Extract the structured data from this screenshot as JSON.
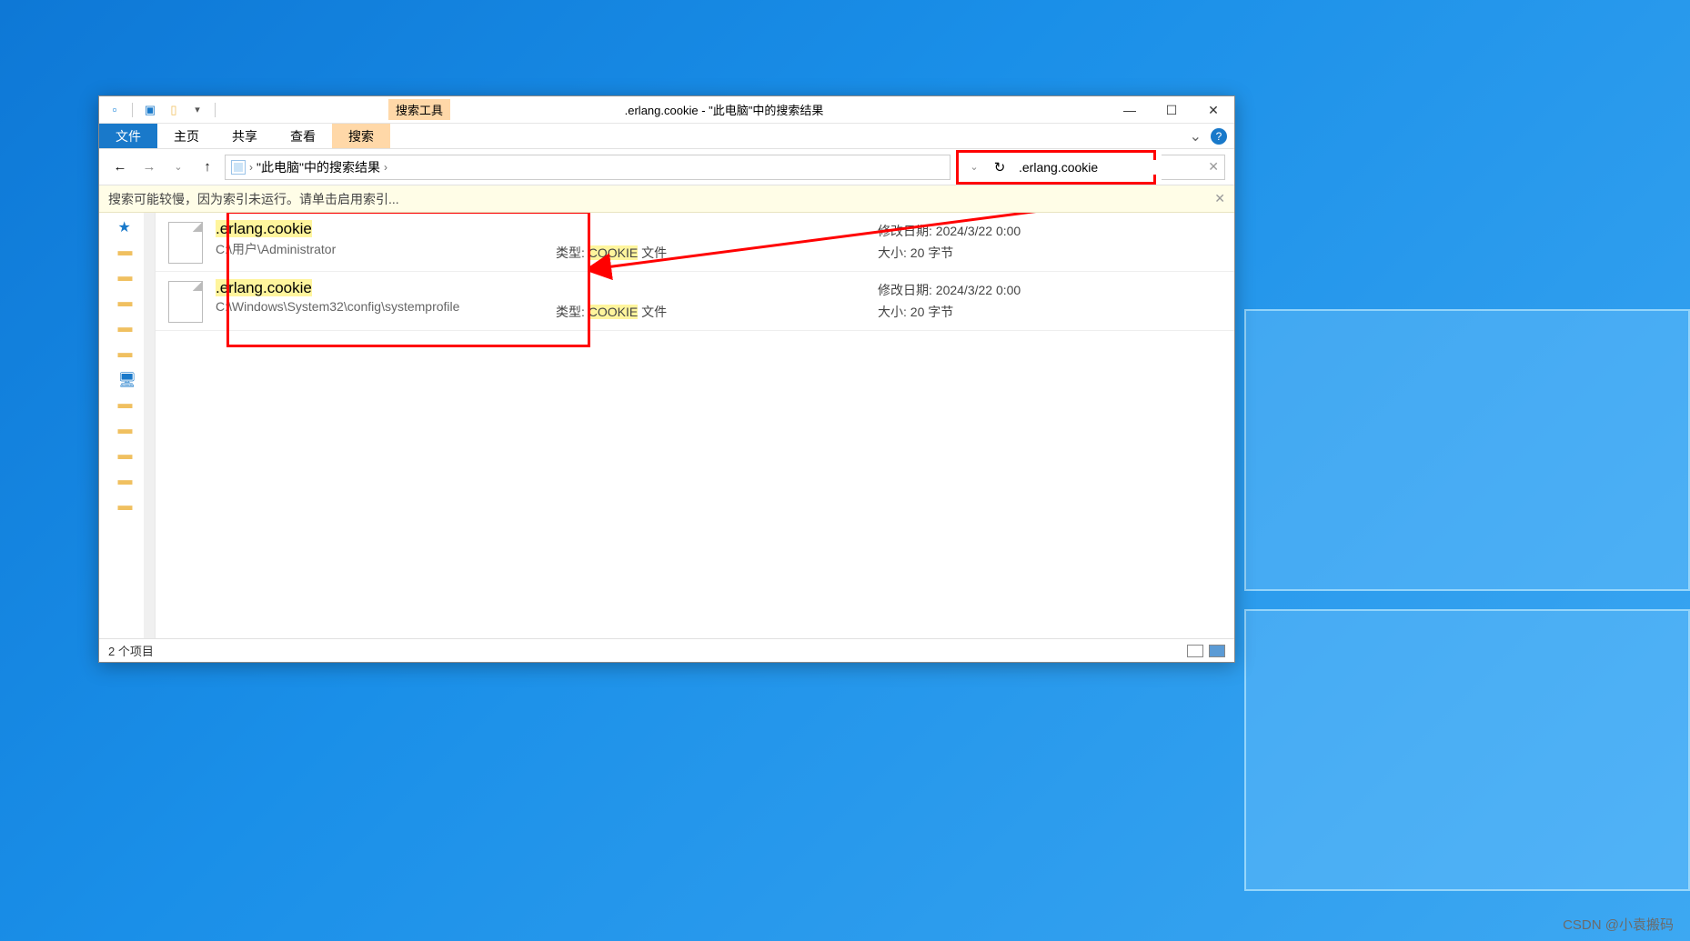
{
  "titlebar": {
    "search_tool_label": "搜索工具",
    "title": ".erlang.cookie - \"此电脑\"中的搜索结果"
  },
  "ribbon": {
    "file": "文件",
    "home": "主页",
    "share": "共享",
    "view": "查看",
    "search": "搜索"
  },
  "breadcrumb": {
    "text": "\"此电脑\"中的搜索结果",
    "sep": "›"
  },
  "search": {
    "value": ".erlang.cookie"
  },
  "infobar": {
    "msg": "搜索可能较慢，因为索引未运行。请单击启用索引..."
  },
  "results": [
    {
      "name": ".erlang.cookie",
      "path": "C:\\用户\\Administrator",
      "type_label": "类型:",
      "type_value": "COOKIE",
      "type_suffix": "文件",
      "date_label": "修改日期:",
      "date_value": "2024/3/22 0:00",
      "size_label": "大小:",
      "size_value": "20 字节"
    },
    {
      "name": ".erlang.cookie",
      "path": "C:\\Windows\\System32\\config\\systemprofile",
      "type_label": "类型:",
      "type_value": "COOKIE",
      "type_suffix": "文件",
      "date_label": "修改日期:",
      "date_value": "2024/3/22 0:00",
      "size_label": "大小:",
      "size_value": "20 字节"
    }
  ],
  "statusbar": {
    "count": "2 个项目"
  },
  "watermark": "CSDN @小袁搬码"
}
